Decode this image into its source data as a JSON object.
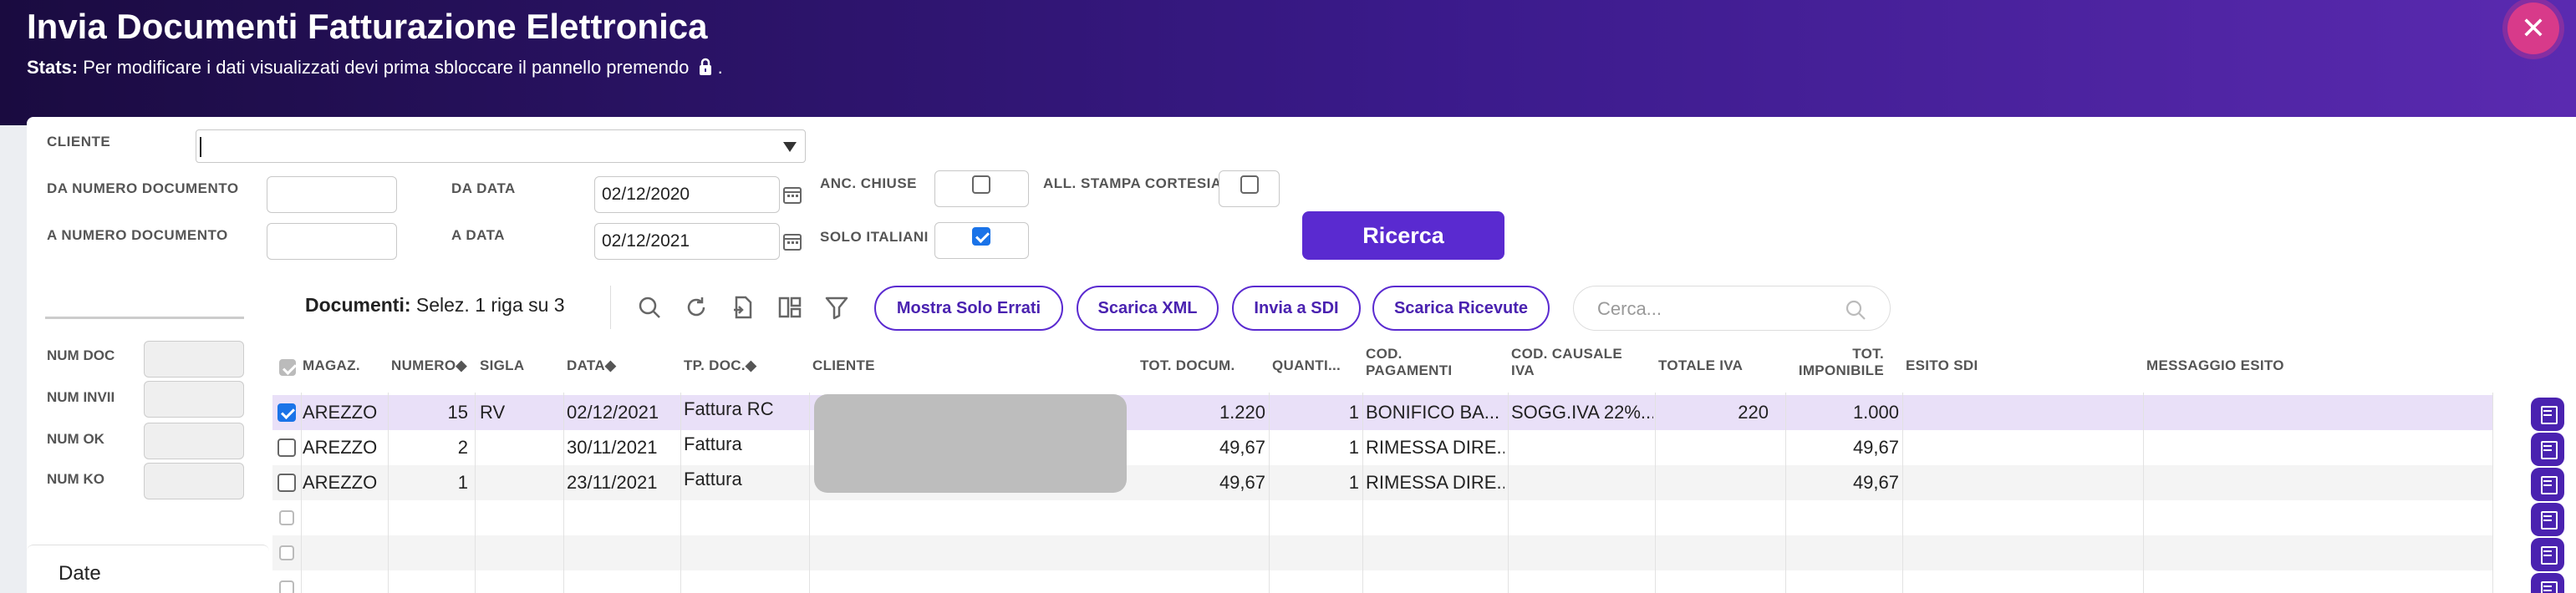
{
  "header": {
    "title": "Invia Documenti Fatturazione Elettronica",
    "stats_label": "Stats:",
    "stats_text": "Per modificare i dati visualizzati devi prima sbloccare il pannello premendo",
    "stats_end": ".",
    "close_glyph": "✕"
  },
  "filters": {
    "cliente_label": "CLIENTE",
    "cliente_value": "",
    "da_numero_label": "DA NUMERO DOCUMENTO",
    "a_numero_label": "A NUMERO DOCUMENTO",
    "da_data_label": "DA DATA",
    "da_data_value": "02/12/2020",
    "a_data_label": "A DATA",
    "a_data_value": "02/12/2021",
    "anc_chiuse_label": "ANC. CHIUSE",
    "anc_chiuse_checked": false,
    "solo_italiani_label": "SOLO ITALIANI",
    "solo_italiani_checked": true,
    "all_stampa_label": "ALL. STAMPA CORTESIA",
    "all_stampa_checked": false,
    "search_button": "Ricerca"
  },
  "sidebar": {
    "num_doc": "NUM DOC",
    "num_invii": "NUM INVII",
    "num_ok": "NUM OK",
    "num_ko": "NUM KO",
    "date_card": "Date"
  },
  "toolbar": {
    "title": "Documenti:",
    "selection": "Selez. 1 riga su 3",
    "btn_errati": "Mostra Solo Errati",
    "btn_xml": "Scarica XML",
    "btn_sdi": "Invia a SDI",
    "btn_ricevute": "Scarica Ricevute",
    "search_placeholder": "Cerca..."
  },
  "table": {
    "columns": {
      "magaz": "MAGAZ.",
      "numero": "NUMERO◆",
      "sigla": "SIGLA",
      "data": "DATA◆",
      "tp_doc": "TP. DOC.◆",
      "cliente": "CLIENTE",
      "tot_docum": "TOT. DOCUM.",
      "quanti": "QUANTI...",
      "cod_pag_1": "COD.",
      "cod_pag_2": "PAGAMENTI",
      "cod_causale_1": "COD. CAUSALE",
      "cod_causale_2": "IVA",
      "totale_iva": "TOTALE IVA",
      "tot_impon_1": "TOT.",
      "tot_impon_2": "IMPONIBILE",
      "esito": "ESITO SDI",
      "messaggio": "MESSAGGIO ESITO"
    },
    "rows": [
      {
        "checked": true,
        "magaz": "AREZZO",
        "numero": "15",
        "sigla": "RV",
        "data": "02/12/2021",
        "tp_doc": "Fattura RC",
        "tot_docum": "1.220",
        "quanti": "1",
        "cod_pag": "BONIFICO BA...",
        "cod_causale": "SOGG.IVA 22%...",
        "totale_iva": "220",
        "tot_impon": "1.000"
      },
      {
        "checked": false,
        "magaz": "AREZZO",
        "numero": "2",
        "sigla": "",
        "data": "30/11/2021",
        "tp_doc": "Fattura",
        "tot_docum": "49,67",
        "quanti": "1",
        "cod_pag": "RIMESSA DIRE...",
        "cod_causale": "",
        "totale_iva": "",
        "tot_impon": "49,67"
      },
      {
        "checked": false,
        "magaz": "AREZZO",
        "numero": "1",
        "sigla": "",
        "data": "23/11/2021",
        "tp_doc": "Fattura",
        "tot_docum": "49,67",
        "quanti": "1",
        "cod_pag": "RIMESSA DIRE...",
        "cod_causale": "",
        "totale_iva": "",
        "tot_impon": "49,67"
      }
    ]
  },
  "colors": {
    "accent": "#5a2ad0",
    "banner_start": "#1a0b40",
    "banner_end": "#5a2ab0",
    "close": "#d83a8a",
    "selected_row": "#e9e0f8"
  }
}
